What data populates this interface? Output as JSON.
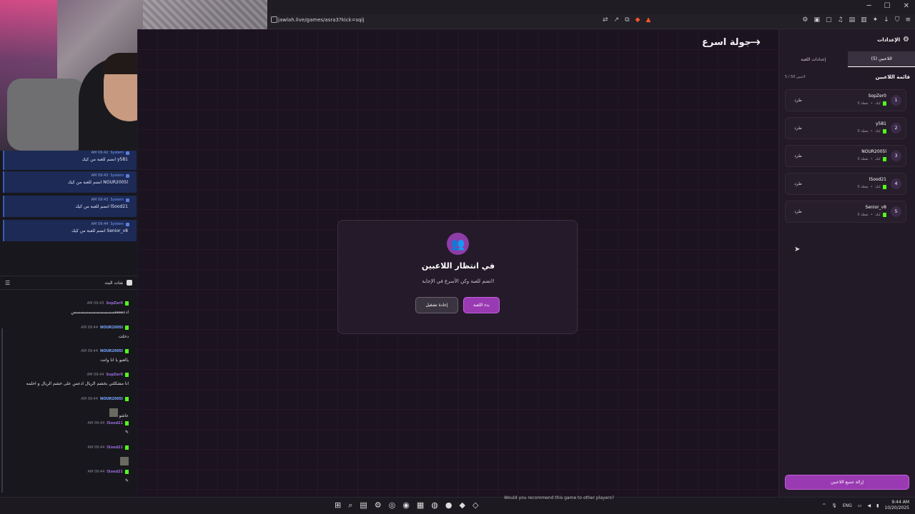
{
  "browser": {
    "url": "jawlah.live/games/asra3?kick=sqij"
  },
  "game": {
    "title": "جولة اسرع",
    "waiting_title": "في انتظار اللاعبين",
    "waiting_subtitle": "انضم للعبة وكن الأسرع في الإجابة!",
    "start_button": "بدء اللعبة",
    "restart_button": "إعادة تشغيل"
  },
  "panel": {
    "title": "الإعدادات",
    "tabs": [
      "اللاعبين (5)",
      "إعدادات اللعبة"
    ],
    "list_title": "قائمة اللاعبين",
    "player_count": "5 / 50 لاعبين",
    "kick_label": "طرد",
    "points_label": "0 نقطة",
    "platform_label": "كيك",
    "players": [
      {
        "num": "1",
        "name": "SopZer0"
      },
      {
        "num": "2",
        "name": "y581"
      },
      {
        "num": "3",
        "name": "NOUR2005l"
      },
      {
        "num": "4",
        "name": "lSood21"
      },
      {
        "num": "5",
        "name": "Senior_v8"
      }
    ],
    "remove_all": "إزالة جميع اللاعبين"
  },
  "system_messages": [
    {
      "time": "AM 09:42",
      "tag": "System",
      "text": "y581 انضم للعبة من كيك"
    },
    {
      "time": "AM 09:43",
      "tag": "System",
      "text": "NOUR2005l انضم للعبة من كيك"
    },
    {
      "time": "AM 09:43",
      "tag": "System",
      "text": "lSood21 انضم للعبة من كيك"
    },
    {
      "time": "AM 09:44",
      "tag": "System",
      "text": "Senior_v8 انضم للعبة من كيك"
    }
  ],
  "chat": {
    "title": "شات البث",
    "messages": [
      {
        "time": "AM 09:43",
        "user": "SopZer0",
        "text": "ادعععععسسسسسسسسسسس"
      },
      {
        "time": "AM 09:44",
        "user": "NOUR2005l",
        "text": "دخلت"
      },
      {
        "time": "AM 09:44",
        "user": "NOUR2005l",
        "text": "يالعبو يا انا وانت"
      },
      {
        "time": "AM 09:44",
        "user": "SopZer0",
        "text": "انا مشكلتي بخشم الريال ادعس على خشم الريال و احلمه"
      },
      {
        "time": "AM 09:44",
        "user": "NOUR2005l",
        "text": "عاشو"
      },
      {
        "time": "AM 09:44",
        "user": "lSood21",
        "text": ""
      },
      {
        "time": "AM 09:44",
        "user": "lSood21",
        "text": ""
      },
      {
        "time": "AM 09:44",
        "user": "lSood21",
        "text": ""
      }
    ]
  },
  "taskbar": {
    "caption": "Would you recommend this game to other players?",
    "lang": "ENG",
    "time": "9:44 AM",
    "date": "10/20/2025"
  },
  "colors": {
    "accent": "#9a3ab2",
    "kick_green": "#53fc18",
    "background": "#1b1320"
  }
}
